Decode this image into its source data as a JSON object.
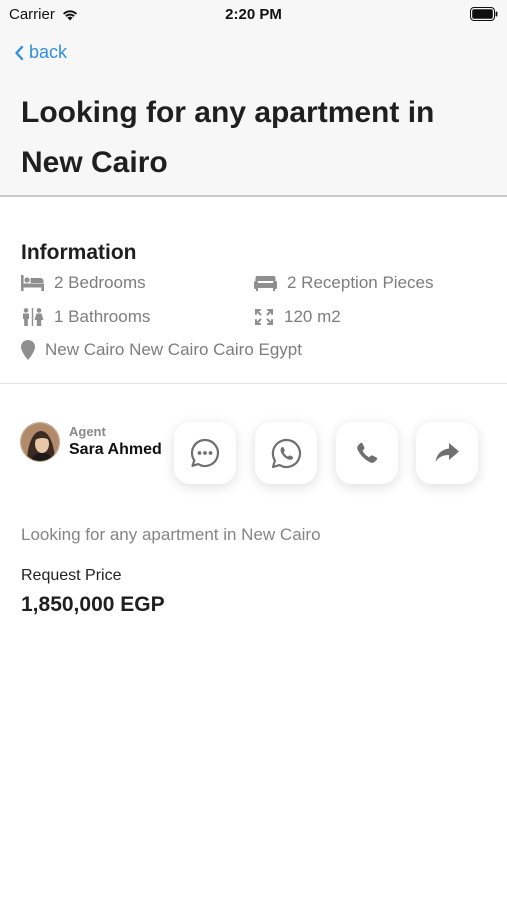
{
  "status_bar": {
    "carrier": "Carrier",
    "time": "2:20 PM"
  },
  "header": {
    "back_label": "back",
    "title": "Looking for any apartment in New Cairo"
  },
  "information": {
    "title": "Information",
    "bedrooms": "2 Bedrooms",
    "reception": "2 Reception Pieces",
    "bathrooms": "1 Bathrooms",
    "area": "120 m2",
    "location": "New Cairo New Cairo Cairo Egypt"
  },
  "agent": {
    "label": "Agent",
    "name": "Sara Ahmed"
  },
  "actions": [
    {
      "icon": "chat-bubble-icon"
    },
    {
      "icon": "whatsapp-icon"
    },
    {
      "icon": "phone-icon"
    },
    {
      "icon": "share-icon"
    }
  ],
  "description": "Looking for any apartment in New Cairo",
  "price": {
    "label": "Request Price",
    "value": "1,850,000 EGP"
  },
  "colors": {
    "accent": "#2f8fe0",
    "header_bg": "#f7f7f7",
    "muted_text": "#7d7d7d"
  }
}
